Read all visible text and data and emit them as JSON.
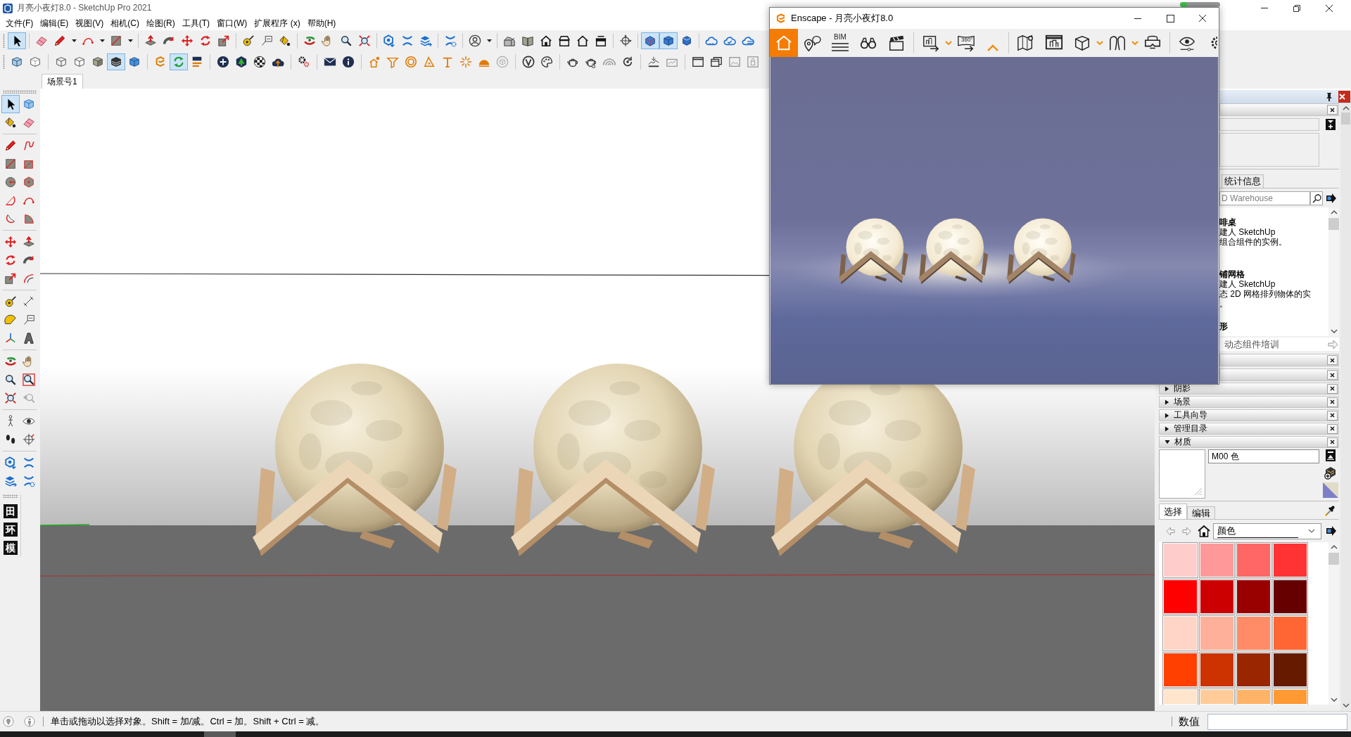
{
  "window": {
    "title": "月亮小夜灯8.0 - SketchUp Pro 2021"
  },
  "loading_bar": {
    "level": 0.18
  },
  "menu": [
    "文件(F)",
    "编辑(E)",
    "视图(V)",
    "相机(C)",
    "绘图(R)",
    "工具(T)",
    "窗口(W)",
    "扩展程序 (x)",
    "帮助(H)"
  ],
  "toolbars": [
    {
      "groups": [
        [
          {
            "kind": "select",
            "selected": true
          }
        ],
        [
          {
            "kind": "eraser",
            "selected": false
          },
          {
            "kind": "pencil",
            "selected": false
          },
          {
            "kind": "caret",
            "selected": false
          },
          {
            "kind": "arc2",
            "selected": false
          },
          {
            "kind": "caret",
            "selected": false
          },
          {
            "kind": "rect",
            "selected": false
          },
          {
            "kind": "caret",
            "selected": false
          }
        ],
        [
          {
            "kind": "pushpull",
            "selected": false
          },
          {
            "kind": "followme",
            "selected": false
          },
          {
            "kind": "move",
            "selected": false
          },
          {
            "kind": "rotate",
            "selected": false
          },
          {
            "kind": "scale",
            "selected": false
          }
        ],
        [
          {
            "kind": "tape",
            "selected": false
          },
          {
            "kind": "text",
            "selected": false
          },
          {
            "kind": "paint",
            "selected": false
          }
        ],
        [
          {
            "kind": "orbit",
            "selected": false
          },
          {
            "kind": "pan",
            "selected": false
          },
          {
            "kind": "zoom",
            "selected": false
          },
          {
            "kind": "zoomext",
            "selected": false
          }
        ],
        [
          {
            "kind": "ext1",
            "selected": false
          },
          {
            "kind": "ext2",
            "selected": false
          },
          {
            "kind": "ext3",
            "selected": false
          }
        ],
        [
          {
            "kind": "ext4",
            "selected": false
          }
        ],
        [
          {
            "kind": "user",
            "selected": false
          },
          {
            "kind": "caret",
            "selected": false
          }
        ],
        [
          {
            "kind": "house3d",
            "selected": false
          },
          {
            "kind": "book",
            "selected": false
          },
          {
            "kind": "house1",
            "selected": false
          },
          {
            "kind": "house2",
            "selected": false
          },
          {
            "kind": "house3",
            "selected": false
          },
          {
            "kind": "house4",
            "selected": false
          }
        ],
        [
          {
            "kind": "crosshair",
            "selected": false
          }
        ],
        [
          {
            "kind": "view1",
            "selected": true
          },
          {
            "kind": "view2",
            "selected": true
          },
          {
            "kind": "view3",
            "selected": false
          }
        ],
        [
          {
            "kind": "cloud1",
            "selected": false
          },
          {
            "kind": "cloud2",
            "selected": false
          },
          {
            "kind": "cloud3",
            "selected": false
          }
        ]
      ]
    },
    {
      "groups": [
        [
          {
            "kind": "xray",
            "selected": false
          },
          {
            "kind": "backedges",
            "selected": false
          }
        ],
        [
          {
            "kind": "wire",
            "selected": false
          },
          {
            "kind": "hidden",
            "selected": false
          },
          {
            "kind": "shaded",
            "selected": false
          },
          {
            "kind": "textured",
            "selected": true
          },
          {
            "kind": "mono",
            "selected": false
          }
        ],
        [
          {
            "kind": "elogo",
            "selected": false
          },
          {
            "kind": "sync",
            "selected": true
          },
          {
            "kind": "bars",
            "selected": false
          }
        ],
        [
          {
            "kind": "plus",
            "selected": false
          },
          {
            "kind": "tree",
            "selected": false
          },
          {
            "kind": "checker",
            "selected": false
          },
          {
            "kind": "upload",
            "selected": false
          }
        ],
        [
          {
            "kind": "gears",
            "selected": false
          }
        ],
        [
          {
            "kind": "envelope",
            "selected": false
          },
          {
            "kind": "info",
            "selected": false
          }
        ],
        [
          {
            "kind": "o1",
            "selected": false
          },
          {
            "kind": "o2",
            "selected": false
          },
          {
            "kind": "o3",
            "selected": false
          },
          {
            "kind": "o4",
            "selected": false
          },
          {
            "kind": "o5",
            "selected": false
          },
          {
            "kind": "o6",
            "selected": false
          },
          {
            "kind": "o7",
            "selected": false
          },
          {
            "kind": "o8",
            "selected": false
          }
        ],
        [
          {
            "kind": "vlogo",
            "selected": false
          },
          {
            "kind": "palette",
            "selected": false
          }
        ],
        [
          {
            "kind": "teapot",
            "selected": false
          },
          {
            "kind": "teapothand",
            "selected": false
          },
          {
            "kind": "rings",
            "selected": false
          },
          {
            "kind": "refresh",
            "selected": false
          }
        ],
        [
          {
            "kind": "terrain",
            "selected": false
          },
          {
            "kind": "terrain2",
            "selected": false
          }
        ],
        [
          {
            "kind": "w1",
            "selected": false
          },
          {
            "kind": "w2",
            "selected": false
          },
          {
            "kind": "w3",
            "selected": false
          },
          {
            "kind": "w4",
            "selected": false
          }
        ]
      ]
    }
  ],
  "scene_tabs": [
    {
      "label": "场景号1",
      "selected": true
    }
  ],
  "tool_palette": {
    "groups": [
      [
        {
          "kind": "select",
          "selected": true
        },
        {
          "kind": "component",
          "selected": false
        },
        {
          "kind": "paint",
          "selected": false
        },
        {
          "kind": "eraser",
          "selected": false
        }
      ],
      [
        {
          "kind": "pencil",
          "selected": false
        },
        {
          "kind": "freehand",
          "selected": false
        },
        {
          "kind": "rect",
          "selected": false
        },
        {
          "kind": "rotrect",
          "selected": false
        },
        {
          "kind": "circle",
          "selected": false
        },
        {
          "kind": "polygon",
          "selected": false
        },
        {
          "kind": "arc",
          "selected": false
        },
        {
          "kind": "arc2",
          "selected": false
        },
        {
          "kind": "arc3",
          "selected": false
        },
        {
          "kind": "pie",
          "selected": false
        }
      ],
      [
        {
          "kind": "move",
          "selected": false
        },
        {
          "kind": "pushpull",
          "selected": false
        },
        {
          "kind": "rotate",
          "selected": false
        },
        {
          "kind": "followme",
          "selected": false
        },
        {
          "kind": "scale",
          "selected": false
        },
        {
          "kind": "offset",
          "selected": false
        }
      ],
      [
        {
          "kind": "tape",
          "selected": false
        },
        {
          "kind": "dimension",
          "selected": false
        },
        {
          "kind": "protractor",
          "selected": false
        },
        {
          "kind": "text",
          "selected": false
        },
        {
          "kind": "axes",
          "selected": false
        },
        {
          "kind": "text3d",
          "selected": false
        }
      ],
      [
        {
          "kind": "orbit",
          "selected": false
        },
        {
          "kind": "pan",
          "selected": false
        },
        {
          "kind": "zoom",
          "selected": false
        },
        {
          "kind": "zoomwin",
          "selected": false
        },
        {
          "kind": "zoomext",
          "selected": false
        },
        {
          "kind": "previous",
          "selected": false
        }
      ],
      [
        {
          "kind": "walk",
          "selected": false
        },
        {
          "kind": "look",
          "selected": false
        },
        {
          "kind": "position",
          "selected": false
        },
        {
          "kind": "section",
          "selected": false
        }
      ],
      [
        {
          "kind": "ext1",
          "selected": false
        },
        {
          "kind": "ext2",
          "selected": false
        },
        {
          "kind": "ext3",
          "selected": false
        },
        {
          "kind": "ext4",
          "selected": false
        }
      ]
    ]
  },
  "text_tools": [
    {
      "label": "田",
      "selected": false
    },
    {
      "label": "环",
      "selected": false
    },
    {
      "label": "模",
      "selected": false
    }
  ],
  "enscape": {
    "title": "Enscape - 月亮小夜灯8.0",
    "toolbar": [
      [
        {
          "kind": "home",
          "selected": true
        },
        {
          "kind": "pin",
          "selected": false
        },
        {
          "kind": "bim",
          "label": "BIM",
          "selected": false
        },
        {
          "kind": "binoculars",
          "selected": false
        },
        {
          "kind": "clapper",
          "selected": false
        }
      ],
      [
        {
          "kind": "render",
          "selected": false
        },
        {
          "kind": "ecaret",
          "selected": false
        },
        {
          "kind": "pano",
          "label": "360°",
          "selected": false
        },
        {
          "kind": "collapse",
          "selected": false
        }
      ],
      [
        {
          "kind": "map",
          "selected": false
        },
        {
          "kind": "image",
          "selected": false
        },
        {
          "kind": "cube",
          "selected": false
        },
        {
          "kind": "ecaret",
          "selected": false
        },
        {
          "kind": "arches",
          "selected": false
        },
        {
          "kind": "ecaret",
          "selected": false
        },
        {
          "kind": "vr",
          "selected": false
        }
      ],
      [
        {
          "kind": "eye",
          "selected": false
        },
        {
          "kind": "gear",
          "selected": false
        }
      ]
    ]
  },
  "tray": {
    "covered_panels": [
      {
        "kind": "components"
      },
      {
        "kind": "plain"
      },
      {
        "kind": "plain"
      }
    ],
    "components": {
      "tabs": [
        {
          "label": "统计信息",
          "selected": false
        }
      ],
      "search": {
        "placeholder": "D Warehouse"
      },
      "results": [
        {
          "title": "啡桌",
          "lines": [
            "建人 SketchUp",
            "组合组件的实例。"
          ]
        },
        {
          "title": "铺网格",
          "lines": [
            "建人 SketchUp",
            "态 2D 网格排列物体的实",
            "。"
          ]
        },
        {
          "title": "形"
        }
      ],
      "footer_link": "动态组件培训"
    },
    "panels": [
      {
        "label": "阴影",
        "expanded": false
      },
      {
        "label": "场景",
        "expanded": false
      },
      {
        "label": "工具向导",
        "expanded": false
      },
      {
        "label": "管理目录",
        "expanded": false
      },
      {
        "label": "材质",
        "expanded": true
      }
    ],
    "materials": {
      "name": "M00 色",
      "tabs": [
        {
          "label": "选择",
          "selected": true
        },
        {
          "label": "编辑",
          "selected": false
        }
      ],
      "library": "颜色",
      "swatches": [
        {
          "color": "#ffcccc"
        },
        {
          "color": "#ff9999"
        },
        {
          "color": "#ff6666"
        },
        {
          "color": "#ff3333"
        },
        {
          "color": "#ff0000"
        },
        {
          "color": "#cc0000"
        },
        {
          "color": "#990000"
        },
        {
          "color": "#660000"
        },
        {
          "color": "#ffd5c8"
        },
        {
          "color": "#ffb09a"
        },
        {
          "color": "#ff8c66"
        },
        {
          "color": "#ff6633"
        },
        {
          "color": "#ff4000"
        },
        {
          "color": "#cc3300"
        },
        {
          "color": "#992600"
        },
        {
          "color": "#661a00"
        },
        {
          "color": "#ffe5cc"
        },
        {
          "color": "#ffcc99"
        },
        {
          "color": "#ffb366"
        },
        {
          "color": "#ff9933"
        }
      ]
    }
  },
  "status_bar": {
    "hint": "单击或拖动以选择对象。Shift = 加/减。Ctrl = 加。Shift + Ctrl = 减。",
    "measurements_label": "数值"
  }
}
